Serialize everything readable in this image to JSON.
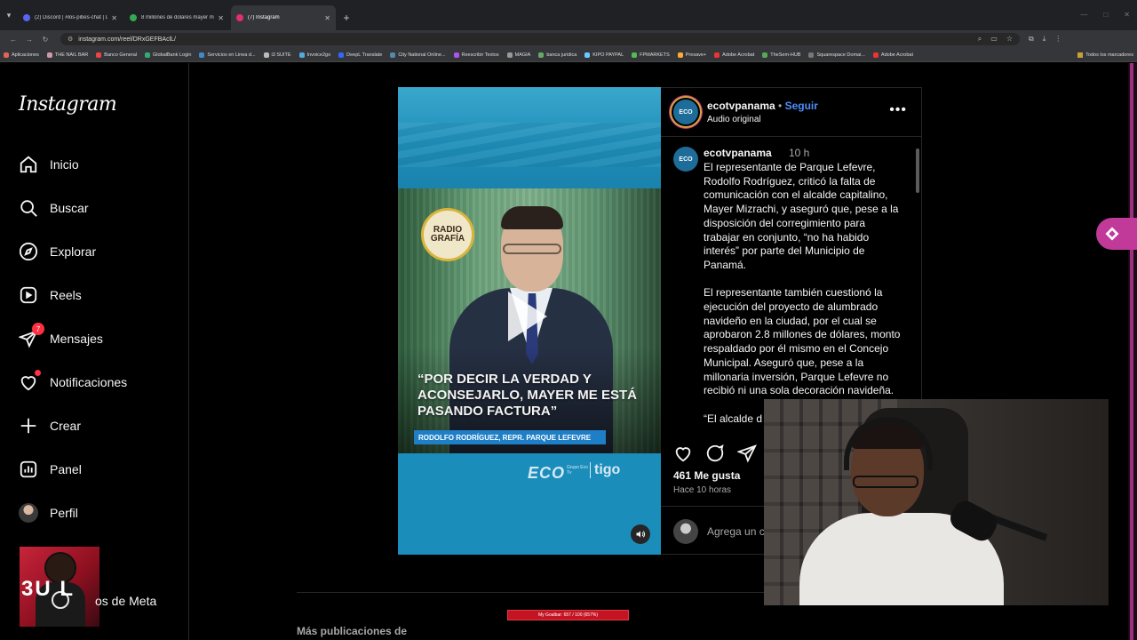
{
  "browser": {
    "tabs": [
      {
        "label": "(2) Discord | #los-pibes-chat | L",
        "active": false,
        "favicon_color": "#5865f2"
      },
      {
        "label": "8 millones de dolares mayer m",
        "active": false,
        "favicon_color": "#34a853"
      },
      {
        "label": "(7) Instagram",
        "active": true,
        "favicon_color": "#e1306c"
      }
    ],
    "url": "instagram.com/reel/DRxGEFBAclL/",
    "bookmarks": [
      "Aplicaciones",
      "THE NAIL BAR",
      "Banco General",
      "GlobalBank Login",
      "Servicios en Linea d...",
      "i3 SUITE",
      "Invoice2go",
      "DeepL Translate",
      "City National Online...",
      "Reescribir Textos",
      "MAGIA",
      "banca juridica",
      "KIPO PAYPAL",
      "FPMARKETS",
      "Presave+",
      "Adobe Acrobat",
      "TheSem-HUB",
      "Squarespace Domai...",
      "Adobe Acrobat"
    ],
    "bookmarks_right": "Todos los marcadores"
  },
  "instagram": {
    "logo": "Instagram",
    "nav": [
      {
        "label": "Inicio",
        "icon": "home-icon"
      },
      {
        "label": "Buscar",
        "icon": "search-icon"
      },
      {
        "label": "Explorar",
        "icon": "compass-icon"
      },
      {
        "label": "Reels",
        "icon": "reels-icon"
      },
      {
        "label": "Mensajes",
        "icon": "messenger-icon",
        "badge": "7"
      },
      {
        "label": "Notificaciones",
        "icon": "heart-icon",
        "dot": true
      },
      {
        "label": "Crear",
        "icon": "plus-icon"
      },
      {
        "label": "Panel",
        "icon": "dashboard-icon"
      },
      {
        "label": "Perfil",
        "icon": "avatar"
      }
    ],
    "more_from_meta": "os de Meta",
    "more_from_meta_thumb_text": "3U L"
  },
  "post": {
    "video": {
      "badge_line1": "RADIO",
      "badge_line2": "GRAFÍA",
      "quote": "“POR DECIR LA VERDAD Y ACONSEJARLO, MAYER ME ESTÁ PASANDO FACTURA”",
      "lower_third": "RODOLFO RODRÍGUEZ, REPR. PARQUE LEFEVRE",
      "logo_main": "ECO",
      "logo_sub": "Grupo Eco Tv",
      "logo_partner": "tigo"
    },
    "header": {
      "avatar_text": "ECO",
      "username": "ecotvpanama",
      "separator": "•",
      "follow": "Seguir",
      "audio": "Audio original",
      "more": "•••"
    },
    "caption": {
      "avatar_text": "ECO",
      "username": "ecotvpanama",
      "time": "10 h",
      "text": "El representante de Parque Lefevre, Rodolfo Rodríguez, criticó la falta de comunicación con el alcalde capitalino, Mayer Mizrachi, y aseguró que, pese a la disposición del corregimiento para trabajar en conjunto, “no ha habido interés” por parte del Municipio de Panamá.\n\nEl representante también cuestionó la ejecución del proyecto de alumbrado navideño en la ciudad, por el cual se aprobaron 2.8 millones de dólares, monto respaldado por él mismo en el Concejo Municipal. Aseguró que, pese a la millonaria inversión, Parque Lefevre no recibió ni una sola decoración navideña.\n\n“El alcalde d"
    },
    "likes": "461 Me gusta",
    "time_ago": "Hace 10 horas",
    "comment_placeholder": "Agrega un c"
  },
  "feed_more": "Más publicaciones de",
  "stream_goal": "My Goalbar: 657 / 100 (657%)"
}
